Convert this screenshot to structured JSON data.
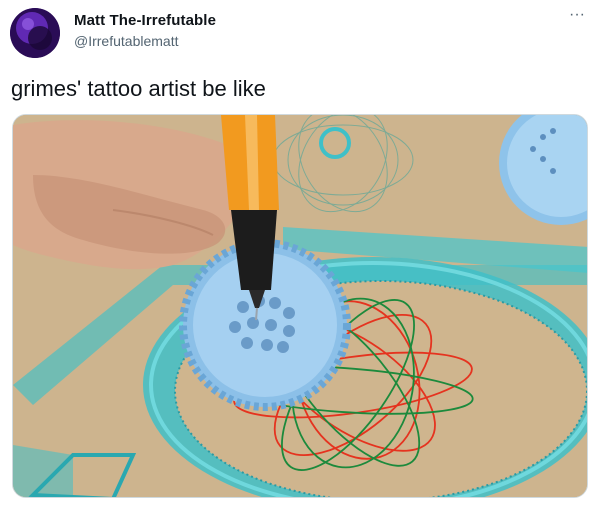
{
  "author": {
    "display_name": "Matt The-Irrefutable",
    "handle": "@Irrefutablematt"
  },
  "more_menu": {
    "glyph": "···"
  },
  "tweet": {
    "text": "grimes' tattoo artist be like"
  },
  "media": {
    "alt": "Hand drawing a spirograph pattern with a pen inside a blue gear on cardboard"
  },
  "colors": {
    "text": "#0f1419",
    "secondary": "#536471",
    "spiro_blue": "#8fc3ea",
    "ruler_teal": "#3fc0c8",
    "pen_orange": "#f29a1f",
    "ink_red": "#e5331f",
    "ink_green": "#1c8a3c"
  },
  "icons": [
    "more-horizontal-icon"
  ]
}
